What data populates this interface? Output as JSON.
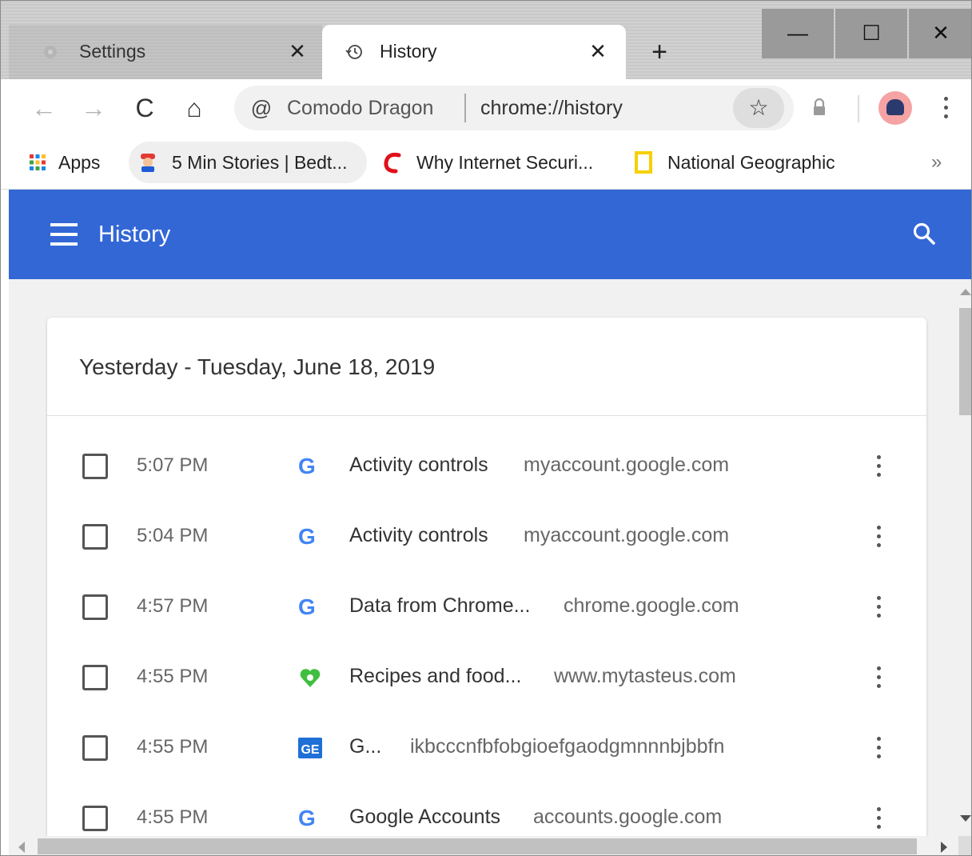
{
  "tabs": [
    {
      "title": "Settings",
      "icon": "gear-icon",
      "close": "✕"
    },
    {
      "title": "History",
      "icon": "history-icon",
      "close": "✕"
    }
  ],
  "new_tab": "+",
  "window_controls": {
    "minimize": "—",
    "maximize": "☐",
    "close": "✕"
  },
  "toolbar": {
    "back": "←",
    "forward": "→",
    "reload": "C",
    "home": "⌂",
    "site_name": "Comodo Dragon",
    "url": "chrome://history",
    "star": "☆"
  },
  "bookmarks": [
    {
      "label": "Apps",
      "icon": "apps-grid-icon"
    },
    {
      "label": "5 Min Stories | Bedt...",
      "icon": "mario-icon"
    },
    {
      "label": "Why Internet Securi...",
      "icon": "comodo-c-icon"
    },
    {
      "label": "National Geographic",
      "icon": "natgeo-icon"
    }
  ],
  "bookmarks_overflow": "»",
  "header": {
    "title": "History"
  },
  "day_heading": "Yesterday - Tuesday, June 18, 2019",
  "entries": [
    {
      "time": "5:07 PM",
      "title": "Activity controls",
      "domain": "myaccount.google.com",
      "favicon": "google-icon"
    },
    {
      "time": "5:04 PM",
      "title": "Activity controls",
      "domain": "myaccount.google.com",
      "favicon": "google-icon"
    },
    {
      "time": "4:57 PM",
      "title": "Data from Chrome...",
      "domain": "chrome.google.com",
      "favicon": "google-icon"
    },
    {
      "time": "4:55 PM",
      "title": "Recipes and food...",
      "domain": "www.mytasteus.com",
      "favicon": "heart-icon"
    },
    {
      "time": "4:55 PM",
      "title": "G...",
      "domain": "ikbcccnfbfobgioefgaodgmnnnbjbbfn",
      "favicon": "ge-icon"
    },
    {
      "time": "4:55 PM",
      "title": "Google Accounts",
      "domain": "accounts.google.com",
      "favicon": "google-icon"
    }
  ],
  "colors": {
    "header_blue": "#3367d6",
    "google_blue": "#4285f4"
  }
}
